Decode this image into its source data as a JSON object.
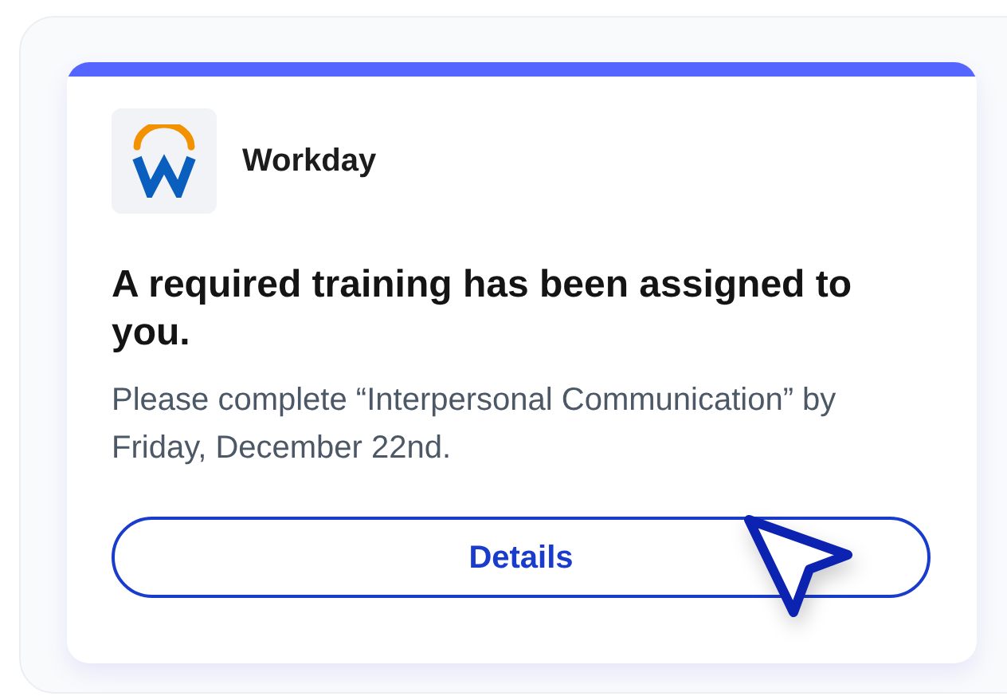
{
  "notification": {
    "app_name": "Workday",
    "title": "A required training has been assigned to you.",
    "message": "Please complete “Interpersonal Communication” by Friday, December 22nd.",
    "button": "Details"
  }
}
